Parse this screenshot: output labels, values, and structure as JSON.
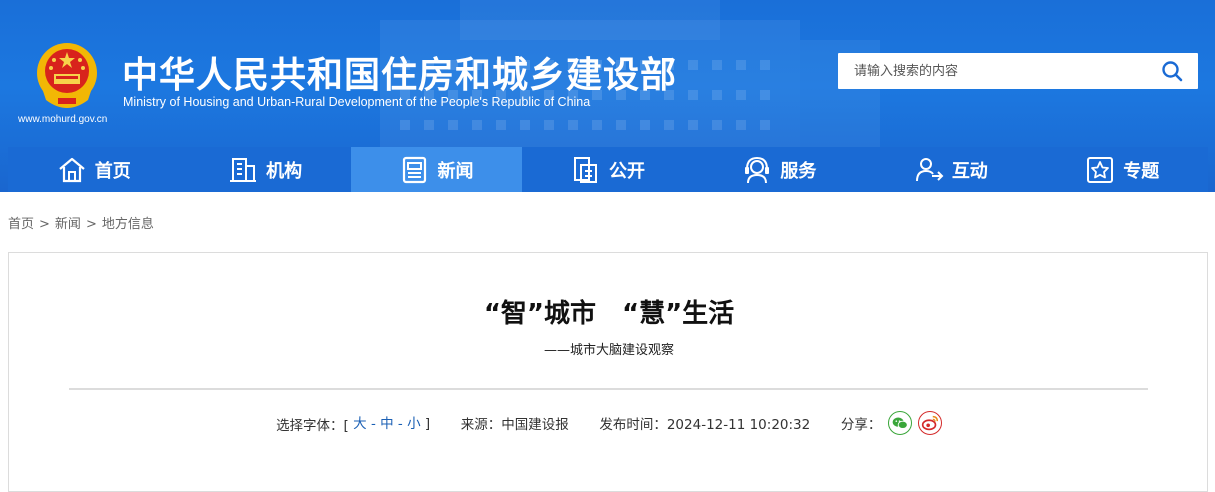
{
  "header": {
    "title_cn": "中华人民共和国住房和城乡建设部",
    "title_en": "Ministry of Housing and Urban-Rural Development of the People's Republic of China",
    "url": "www.mohurd.gov.cn",
    "emblem_icon": "national-emblem-icon"
  },
  "search": {
    "placeholder": "请输入搜索的内容",
    "icon": "search-icon"
  },
  "nav": {
    "items": [
      {
        "label": "首页",
        "icon": "home-icon"
      },
      {
        "label": "机构",
        "icon": "building-icon"
      },
      {
        "label": "新闻",
        "icon": "news-icon",
        "active": true
      },
      {
        "label": "公开",
        "icon": "document-icon"
      },
      {
        "label": "服务",
        "icon": "service-icon"
      },
      {
        "label": "互动",
        "icon": "interaction-icon"
      },
      {
        "label": "专题",
        "icon": "star-icon"
      }
    ]
  },
  "breadcrumb": {
    "items": [
      "首页",
      "新闻",
      "地方信息"
    ],
    "separator": ">"
  },
  "article": {
    "title": "“智”城市　“慧”生活",
    "subtitle": "——城市大脑建设观察",
    "font_size_label": "选择字体：[",
    "font_size_close": "]",
    "font_sizes": [
      "大",
      "中",
      "小"
    ],
    "font_size_dash": "-",
    "source_label": "来源：中国建设报",
    "publish_label": "发布时间：2024-12-11 10:20:32",
    "share_label": "分享：",
    "share_icons": [
      "wechat-icon",
      "weibo-icon"
    ]
  },
  "colors": {
    "header_blue": "#1c78e0",
    "nav_blue": "#1a6ad4",
    "nav_active": "#3d8fea",
    "link_blue": "#1a5fb4"
  }
}
